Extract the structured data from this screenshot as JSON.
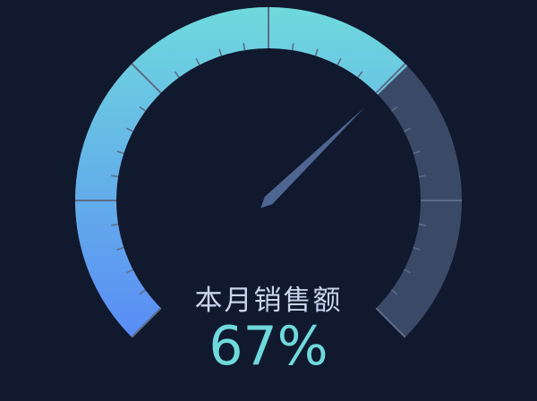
{
  "chart_data": {
    "type": "gauge",
    "name": "本月销售额",
    "value": 67,
    "unit": "%",
    "min": 0,
    "max": 100,
    "colors": {
      "background": "#10192d",
      "progress_start": "#5a8df5",
      "progress_end": "#6fd9dc",
      "track": "#3a4966",
      "tick": "#5d6c86",
      "pointer": "#4e6691",
      "label": "#c9d5ee",
      "value": "#6fd9dc"
    }
  },
  "display": {
    "label": "本月销售额",
    "value_text": "67%"
  }
}
